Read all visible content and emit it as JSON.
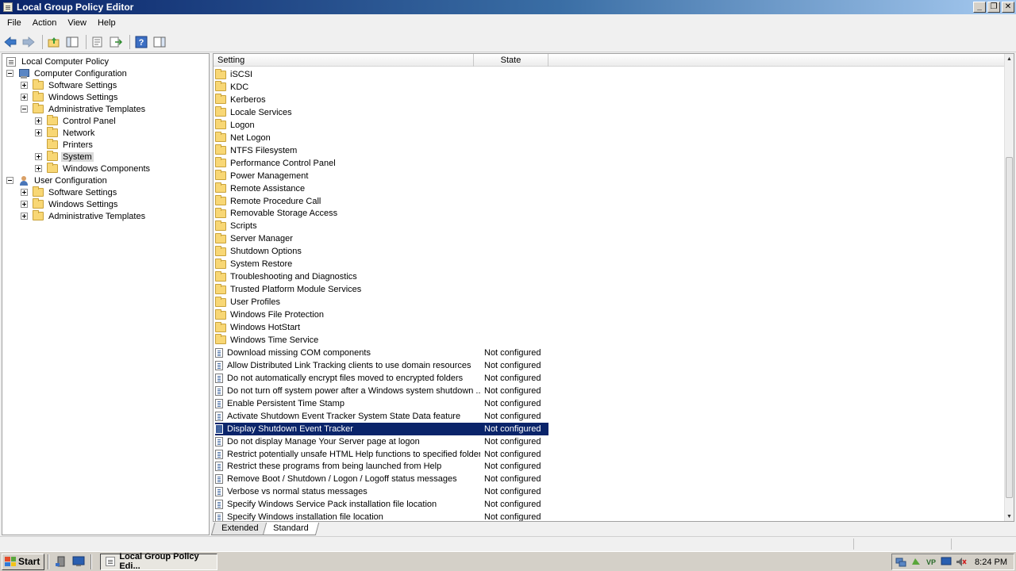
{
  "window": {
    "title": "Local Group Policy Editor"
  },
  "menu": [
    "File",
    "Action",
    "View",
    "Help"
  ],
  "tree": [
    {
      "label": "Local Computer Policy",
      "icon": "gpo",
      "depth": 0,
      "expander": "none"
    },
    {
      "label": "Computer Configuration",
      "icon": "computer",
      "depth": 0,
      "expander": "minus"
    },
    {
      "label": "Software Settings",
      "icon": "folder",
      "depth": 1,
      "expander": "plus"
    },
    {
      "label": "Windows Settings",
      "icon": "folder",
      "depth": 1,
      "expander": "plus"
    },
    {
      "label": "Administrative Templates",
      "icon": "folder",
      "depth": 1,
      "expander": "minus"
    },
    {
      "label": "Control Panel",
      "icon": "folder",
      "depth": 2,
      "expander": "plus"
    },
    {
      "label": "Network",
      "icon": "folder",
      "depth": 2,
      "expander": "plus"
    },
    {
      "label": "Printers",
      "icon": "folder",
      "depth": 2,
      "expander": "none"
    },
    {
      "label": "System",
      "icon": "folder",
      "depth": 2,
      "expander": "plus",
      "selected": true
    },
    {
      "label": "Windows Components",
      "icon": "folder",
      "depth": 2,
      "expander": "plus"
    },
    {
      "label": "User Configuration",
      "icon": "user",
      "depth": 0,
      "expander": "minus"
    },
    {
      "label": "Software Settings",
      "icon": "folder",
      "depth": 1,
      "expander": "plus"
    },
    {
      "label": "Windows Settings",
      "icon": "folder",
      "depth": 1,
      "expander": "plus"
    },
    {
      "label": "Administrative Templates",
      "icon": "folder",
      "depth": 1,
      "expander": "plus"
    }
  ],
  "list": {
    "columns": [
      "Setting",
      "State"
    ],
    "folders": [
      "iSCSI",
      "KDC",
      "Kerberos",
      "Locale Services",
      "Logon",
      "Net Logon",
      "NTFS Filesystem",
      "Performance Control Panel",
      "Power Management",
      "Remote Assistance",
      "Remote Procedure Call",
      "Removable Storage Access",
      "Scripts",
      "Server Manager",
      "Shutdown Options",
      "System Restore",
      "Troubleshooting and Diagnostics",
      "Trusted Platform Module Services",
      "User Profiles",
      "Windows File Protection",
      "Windows HotStart",
      "Windows Time Service"
    ],
    "policies": [
      {
        "name": "Download missing COM components",
        "state": "Not configured"
      },
      {
        "name": "Allow Distributed Link Tracking clients to use domain resources",
        "state": "Not configured"
      },
      {
        "name": "Do not automatically encrypt files moved to encrypted folders",
        "state": "Not configured"
      },
      {
        "name": "Do not turn off system power after a Windows system shutdown ...",
        "state": "Not configured"
      },
      {
        "name": "Enable Persistent Time Stamp",
        "state": "Not configured"
      },
      {
        "name": "Activate Shutdown Event Tracker System State Data feature",
        "state": "Not configured"
      },
      {
        "name": "Display Shutdown Event Tracker",
        "state": "Not configured",
        "selected": true
      },
      {
        "name": "Do not display Manage Your Server page at logon",
        "state": "Not configured"
      },
      {
        "name": "Restrict potentially unsafe HTML Help functions to specified folders",
        "state": "Not configured"
      },
      {
        "name": "Restrict these programs from being launched from Help",
        "state": "Not configured"
      },
      {
        "name": "Remove Boot / Shutdown / Logon / Logoff status messages",
        "state": "Not configured"
      },
      {
        "name": "Verbose vs normal status messages",
        "state": "Not configured"
      },
      {
        "name": "Specify Windows Service Pack installation file location",
        "state": "Not configured"
      },
      {
        "name": "Specify Windows installation file location",
        "state": "Not configured"
      }
    ]
  },
  "tabs": {
    "extended": "Extended",
    "standard": "Standard"
  },
  "taskbar": {
    "start": "Start",
    "task": "Local Group Policy Edi...",
    "clock": "8:24 PM",
    "tray_vp": "VP"
  },
  "colors": {
    "selection": "#0a246a",
    "folder": "#f8d775"
  }
}
